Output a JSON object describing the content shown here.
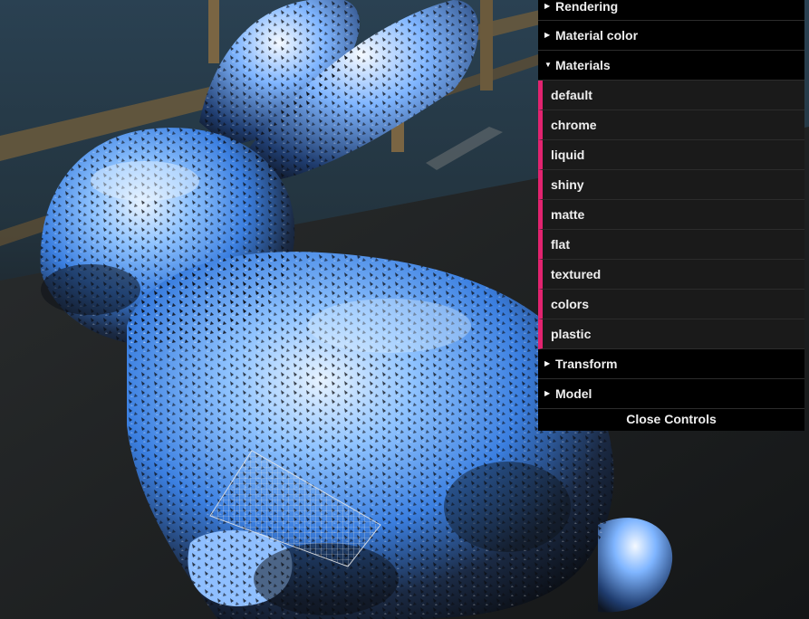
{
  "gui": {
    "folders_top": [
      {
        "label": "Rendering",
        "expanded": false,
        "icon": "triangle-right-icon"
      },
      {
        "label": "Material color",
        "expanded": false,
        "icon": "triangle-right-icon"
      },
      {
        "label": "Materials",
        "expanded": true,
        "icon": "triangle-down-icon"
      }
    ],
    "materials": [
      "default",
      "chrome",
      "liquid",
      "shiny",
      "matte",
      "flat",
      "textured",
      "colors",
      "plastic"
    ],
    "folders_bottom": [
      {
        "label": "Transform",
        "expanded": false,
        "icon": "triangle-right-icon"
      },
      {
        "label": "Model",
        "expanded": false,
        "icon": "triangle-right-icon"
      }
    ],
    "close_label": "Close Controls",
    "accent_color": "#e2236f"
  },
  "scene": {
    "model": "chrome-bunny",
    "background": "road-railing-environment"
  }
}
